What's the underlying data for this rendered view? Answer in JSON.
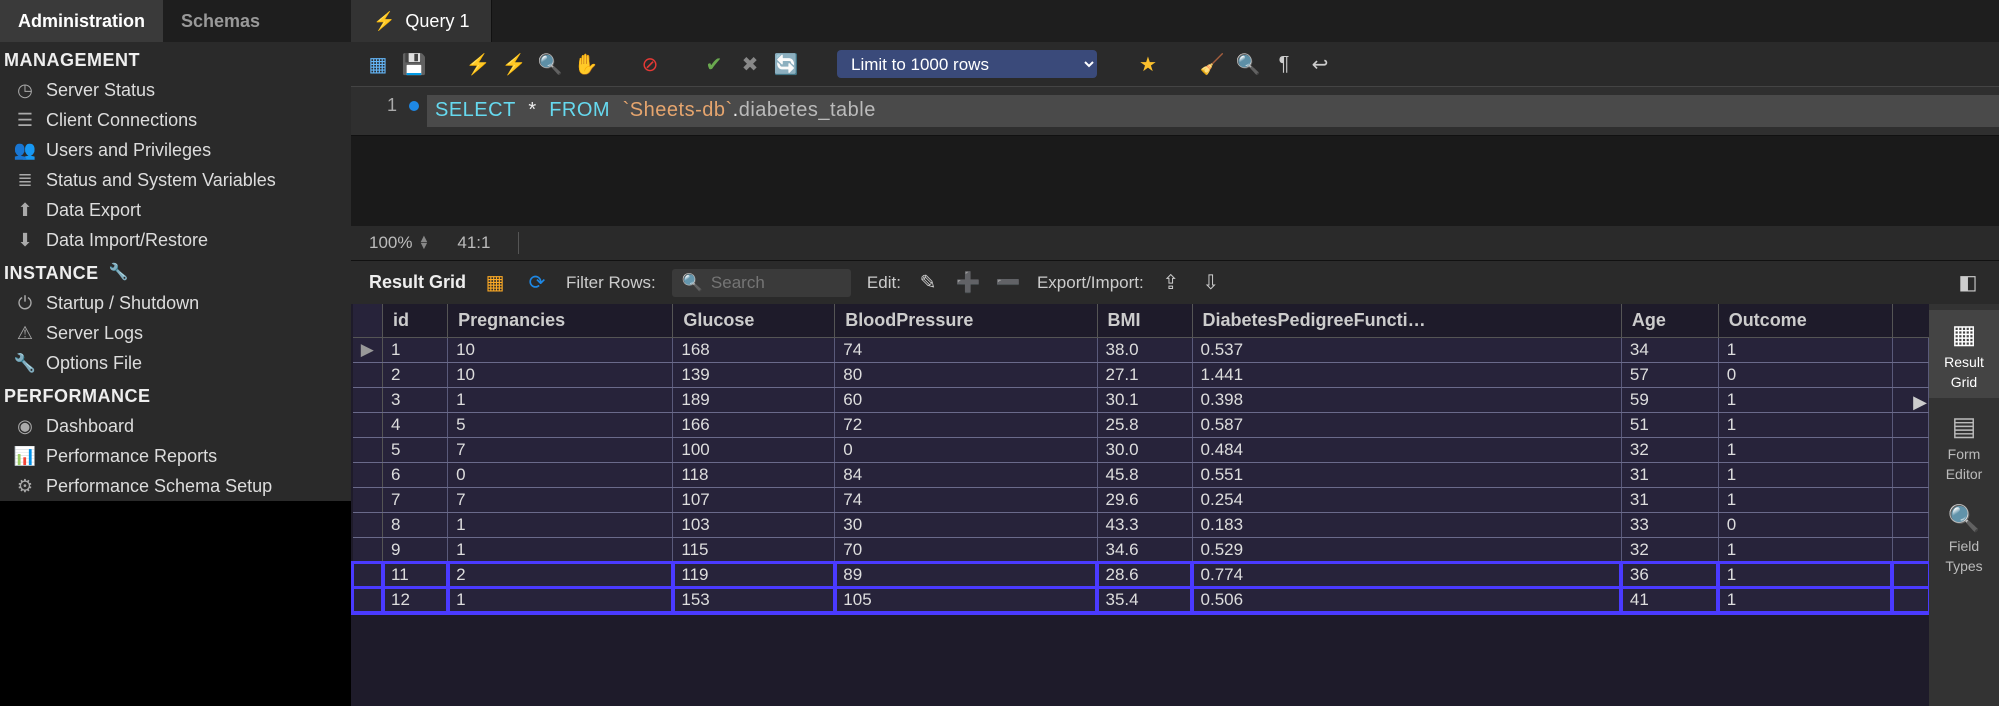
{
  "sidebar": {
    "tabs": [
      {
        "label": "Administration",
        "active": true
      },
      {
        "label": "Schemas",
        "active": false
      }
    ],
    "sections": [
      {
        "title": "MANAGEMENT",
        "items": [
          {
            "label": "Server Status",
            "icon": "gauge-icon"
          },
          {
            "label": "Client Connections",
            "icon": "connections-icon"
          },
          {
            "label": "Users and Privileges",
            "icon": "users-icon"
          },
          {
            "label": "Status and System Variables",
            "icon": "variables-icon"
          },
          {
            "label": "Data Export",
            "icon": "export-icon"
          },
          {
            "label": "Data Import/Restore",
            "icon": "import-icon"
          }
        ]
      },
      {
        "title": "INSTANCE",
        "wrench": true,
        "items": [
          {
            "label": "Startup / Shutdown",
            "icon": "power-icon"
          },
          {
            "label": "Server Logs",
            "icon": "logs-icon"
          },
          {
            "label": "Options File",
            "icon": "options-icon"
          }
        ]
      },
      {
        "title": "PERFORMANCE",
        "items": [
          {
            "label": "Dashboard",
            "icon": "dashboard-icon"
          },
          {
            "label": "Performance Reports",
            "icon": "reports-icon"
          },
          {
            "label": "Performance Schema Setup",
            "icon": "schema-setup-icon"
          }
        ]
      }
    ]
  },
  "query_tabs": [
    {
      "label": "Query 1",
      "icon": "bolt"
    }
  ],
  "toolbar": {
    "limit_options": [
      "Limit to 1000 rows"
    ],
    "limit_selected": "Limit to 1000 rows"
  },
  "editor": {
    "line": "1",
    "sql_parts": {
      "select": "SELECT",
      "star": "*",
      "from": "FROM",
      "db": "`Sheets-db`",
      "dot": ".",
      "table": "diabetes_table"
    }
  },
  "status": {
    "zoom": "100%",
    "cursor": "41:1"
  },
  "result_toolbar": {
    "title": "Result Grid",
    "filter_label": "Filter Rows:",
    "search_placeholder": "Search",
    "edit_label": "Edit:",
    "export_label": "Export/Import:"
  },
  "grid": {
    "columns": [
      "id",
      "Pregnancies",
      "Glucose",
      "BloodPressure",
      "BMI",
      "DiabetesPedigreeFuncti…",
      "Age",
      "Outcome"
    ],
    "current_row_index": 0,
    "highlight_rows": [
      9,
      10
    ],
    "highlight_last_col_index": 7,
    "rows": [
      [
        "1",
        "10",
        "168",
        "74",
        "38.0",
        "0.537",
        "34",
        "1"
      ],
      [
        "2",
        "10",
        "139",
        "80",
        "27.1",
        "1.441",
        "57",
        "0"
      ],
      [
        "3",
        "1",
        "189",
        "60",
        "30.1",
        "0.398",
        "59",
        "1"
      ],
      [
        "4",
        "5",
        "166",
        "72",
        "25.8",
        "0.587",
        "51",
        "1"
      ],
      [
        "5",
        "7",
        "100",
        "0",
        "30.0",
        "0.484",
        "32",
        "1"
      ],
      [
        "6",
        "0",
        "118",
        "84",
        "45.8",
        "0.551",
        "31",
        "1"
      ],
      [
        "7",
        "7",
        "107",
        "74",
        "29.6",
        "0.254",
        "31",
        "1"
      ],
      [
        "8",
        "1",
        "103",
        "30",
        "43.3",
        "0.183",
        "33",
        "0"
      ],
      [
        "9",
        "1",
        "115",
        "70",
        "34.6",
        "0.529",
        "32",
        "1"
      ],
      [
        "11",
        "2",
        "119",
        "89",
        "28.6",
        "0.774",
        "36",
        "1"
      ],
      [
        "12",
        "1",
        "153",
        "105",
        "35.4",
        "0.506",
        "41",
        "1"
      ]
    ]
  },
  "vpalette": [
    {
      "label_line1": "Result",
      "label_line2": "Grid",
      "icon": "grid-icon",
      "active": true
    },
    {
      "label_line1": "Form",
      "label_line2": "Editor",
      "icon": "form-icon",
      "active": false
    },
    {
      "label_line1": "Field",
      "label_line2": "Types",
      "icon": "types-icon",
      "active": false
    }
  ]
}
